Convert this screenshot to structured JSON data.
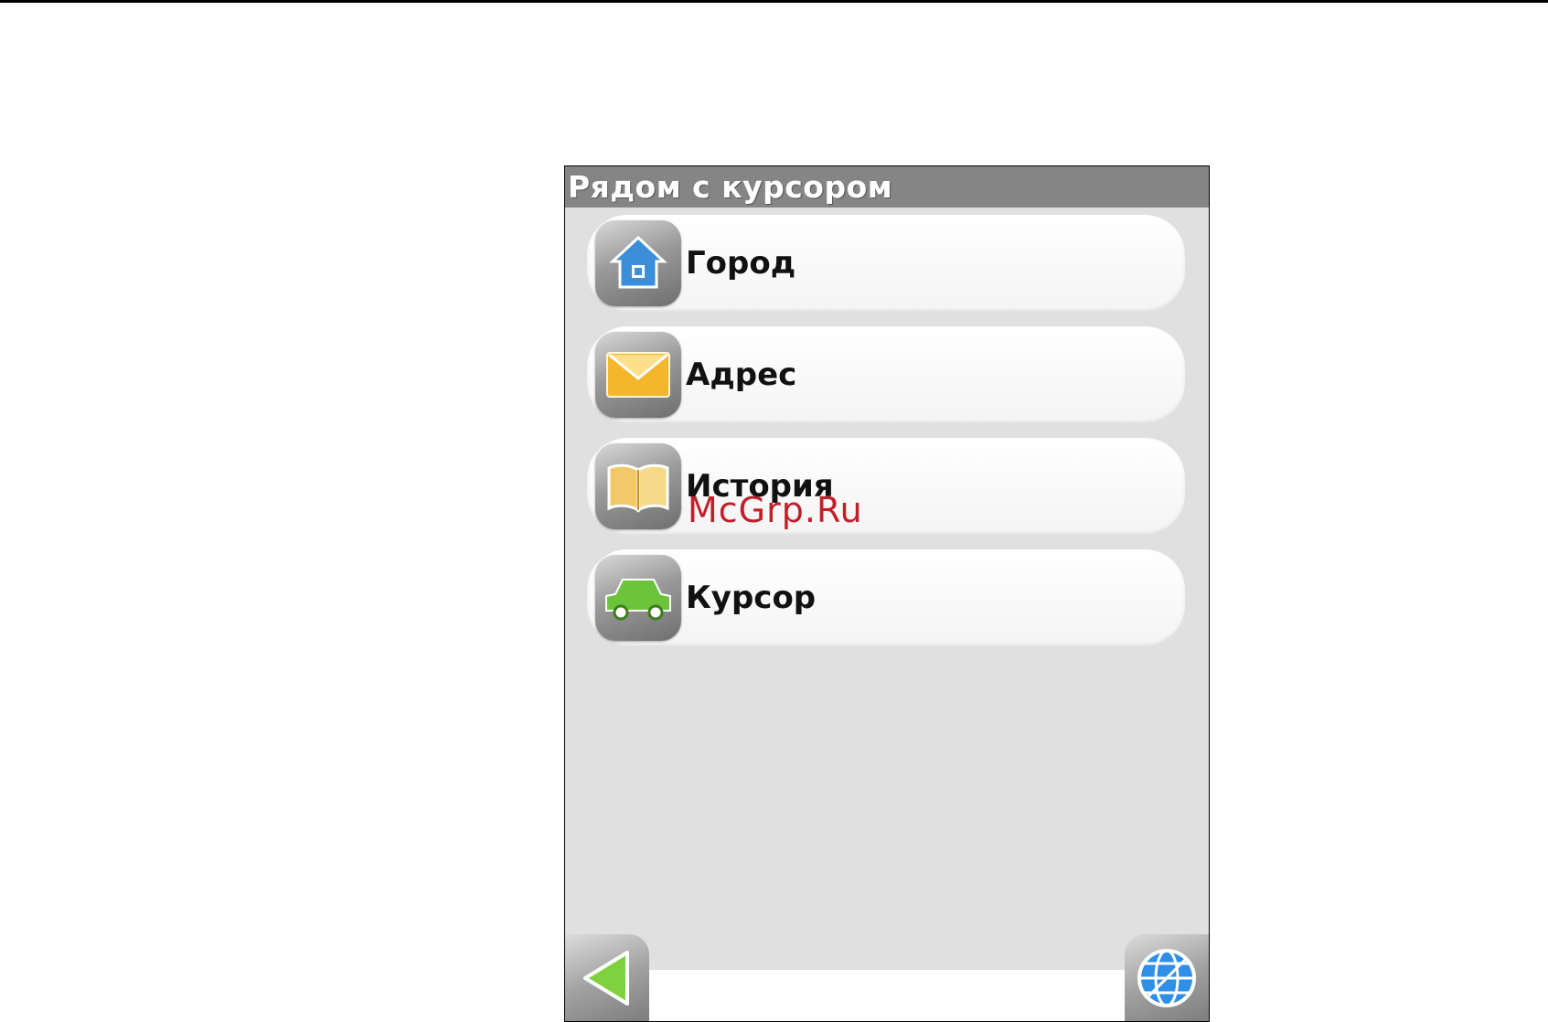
{
  "window": {
    "title": "Рядом с курсором"
  },
  "menu": {
    "items": [
      {
        "label": "Город",
        "icon": "house-icon"
      },
      {
        "label": "Адрес",
        "icon": "envelope-icon"
      },
      {
        "label": "История",
        "icon": "book-icon"
      },
      {
        "label": "Курсор",
        "icon": "car-icon"
      }
    ]
  },
  "toolbar": {
    "back_icon": "back-arrow-icon",
    "globe_icon": "globe-icon"
  },
  "watermark": "McGrp.Ru",
  "colors": {
    "titlebar": "#858585",
    "panel": "#e0e0e0",
    "house": "#3a8fd8",
    "envelope": "#f4b62a",
    "book": "#f1c96b",
    "car": "#6cc43a",
    "back_arrow": "#7fd13f",
    "globe": "#2f8fe6",
    "watermark": "#c0202a"
  }
}
